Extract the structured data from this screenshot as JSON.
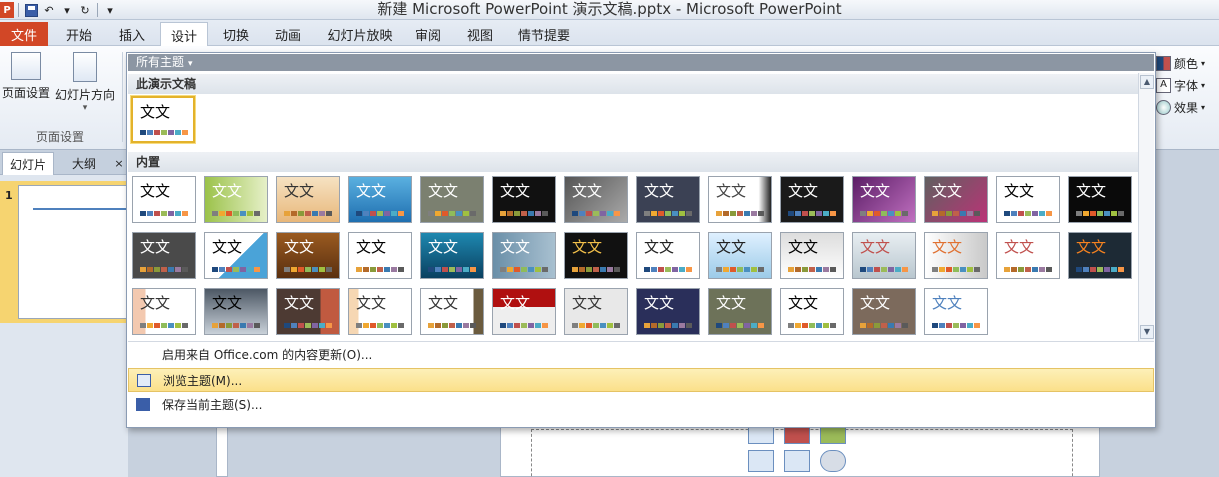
{
  "window": {
    "title": "新建 Microsoft PowerPoint 演示文稿.pptx - Microsoft PowerPoint",
    "app_logo": "P"
  },
  "ribbon": {
    "tabs": [
      {
        "label": "文件",
        "kind": "file"
      },
      {
        "label": "开始"
      },
      {
        "label": "插入"
      },
      {
        "label": "设计",
        "active": true
      },
      {
        "label": "切换"
      },
      {
        "label": "动画"
      },
      {
        "label": "幻灯片放映"
      },
      {
        "label": "审阅"
      },
      {
        "label": "视图"
      },
      {
        "label": "情节提要"
      }
    ],
    "page_setup": {
      "page_setup_label": "页面设置",
      "orientation_label": "幻灯片方向",
      "orientation_caret": "▾",
      "group_label": "页面设置"
    },
    "right_options": {
      "colors_label": "颜色",
      "fonts_label": "字体",
      "effects_label": "效果",
      "caret": "▾"
    }
  },
  "left_pane": {
    "tabs": [
      "幻灯片",
      "大纲"
    ],
    "close_glyph": "×",
    "slide_number": "1"
  },
  "gallery": {
    "header": "所有主题",
    "header_caret": "▾",
    "section_current": "此演示文稿",
    "section_builtin": "内置",
    "sample_text": "文文",
    "menu": {
      "update_label": "启用来自 Office.com 的内容更新(O)...",
      "browse_label": "浏览主题(M)...",
      "save_label": "保存当前主题(S)..."
    },
    "scroll_up": "▲",
    "scroll_down": "▼"
  },
  "colors": {
    "accent_file_tab": "#d24726",
    "highlight": "#fbe08a",
    "selection_border": "#e3b22b"
  }
}
